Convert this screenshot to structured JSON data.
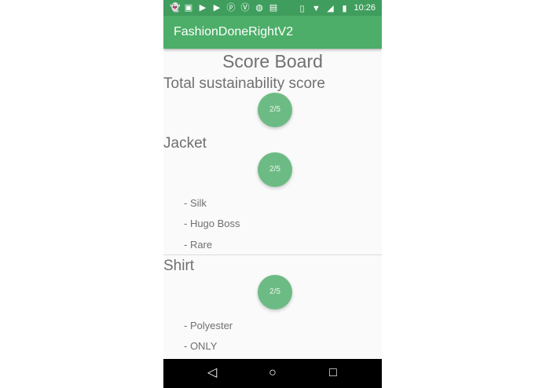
{
  "status_bar": {
    "time": "10:26",
    "left_icons": [
      "ghost-icon",
      "image-icon",
      "youtube-icon",
      "youtube-icon",
      "pinterest-icon",
      "vine-icon",
      "android-icon",
      "photo-icon"
    ],
    "right_icons": [
      "vibrate-icon",
      "wifi-icon",
      "signal-icon",
      "battery-icon"
    ]
  },
  "app_bar": {
    "title": "FashionDoneRightV2",
    "color": "#4cae68"
  },
  "board": {
    "title": "Score Board"
  },
  "total": {
    "label": "Total sustainability score",
    "score": "2/5"
  },
  "items": [
    {
      "name": "Jacket",
      "score": "2/5",
      "details": [
        "- Silk",
        "- Hugo Boss",
        "- Rare"
      ]
    },
    {
      "name": "Shirt",
      "score": "2/5",
      "details": [
        "- Polyester",
        "- ONLY"
      ]
    }
  ],
  "nav_bar": {
    "back": "◁",
    "home": "○",
    "recents": "□"
  }
}
